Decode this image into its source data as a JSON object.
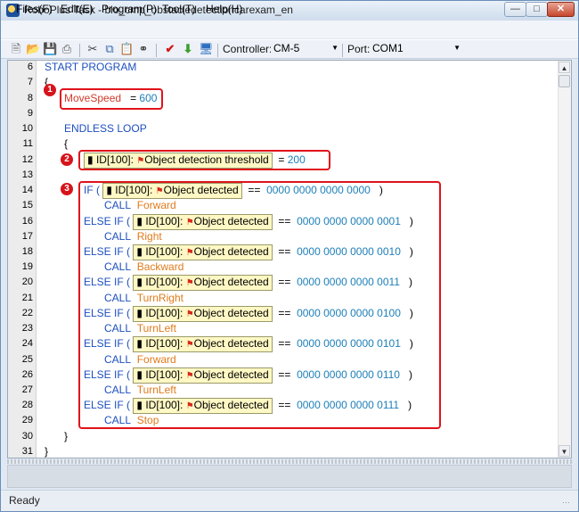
{
  "window": {
    "title": "RoboPlus Task - bio_cmp_obstacledetectioncarexam_en"
  },
  "menu": [
    "Files(F)",
    "Edit(E)",
    "Program(P)",
    "Tool(T)",
    "Help(H)"
  ],
  "toolbar": {
    "controller_label": "Controller:",
    "controller_value": "CM-5",
    "port_label": "Port:",
    "port_value": "COM1"
  },
  "editor": {
    "line_numbers": [
      "6",
      "7",
      "8",
      "9",
      "10",
      "11",
      "12",
      "13",
      "14",
      "15",
      "16",
      "17",
      "18",
      "19",
      "20",
      "21",
      "22",
      "23",
      "24",
      "25",
      "26",
      "27",
      "28",
      "29",
      "30",
      "31"
    ],
    "start_program": "START PROGRAM",
    "open_brace": "{",
    "close_brace": "}",
    "move_speed_var": "MoveSpeed",
    "equals": "=",
    "move_speed_value": "600",
    "endless_loop": "ENDLESS LOOP",
    "threshold_device": "ID[100]:",
    "threshold_param": "Object detection threshold",
    "threshold_value": "200",
    "if_kw": "IF (",
    "else_if_kw": "ELSE IF (",
    "close_paren": ")",
    "eqeq": "==",
    "call_kw": "CALL",
    "device": "ID[100]:",
    "param": "Object detected",
    "branches": [
      {
        "value": "0000 0000 0000 0000",
        "call": "Forward"
      },
      {
        "value": "0000 0000 0000 0001",
        "call": "Right"
      },
      {
        "value": "0000 0000 0000 0010",
        "call": "Backward"
      },
      {
        "value": "0000 0000 0000 0011",
        "call": "TurnRight"
      },
      {
        "value": "0000 0000 0000 0100",
        "call": "TurnLeft"
      },
      {
        "value": "0000 0000 0000 0101",
        "call": "Forward"
      },
      {
        "value": "0000 0000 0000 0110",
        "call": "TurnLeft"
      },
      {
        "value": "0000 0000 0000 0111",
        "call": "Stop"
      }
    ]
  },
  "callouts": [
    "1",
    "2",
    "3"
  ],
  "status": {
    "text": "Ready"
  },
  "colors": {
    "callout": "#e0131a",
    "keyword": "#1d4fbf",
    "call_target": "#e07b1c",
    "number": "#1d7fb8"
  }
}
